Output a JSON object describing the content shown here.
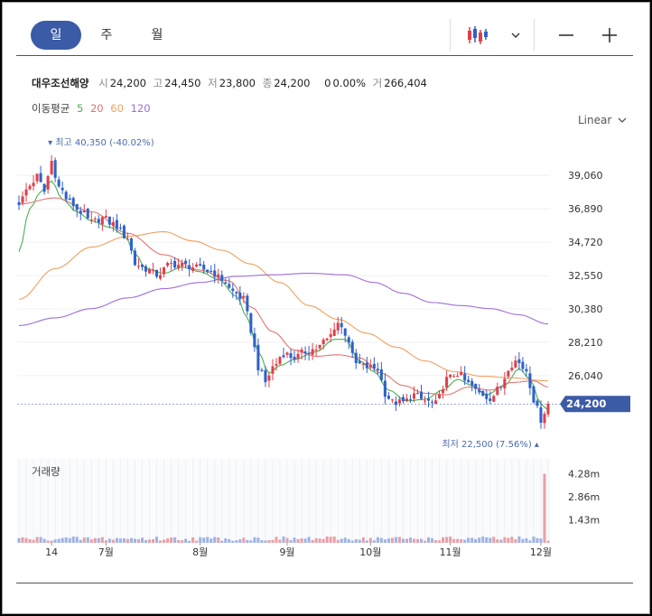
{
  "tabs": [
    {
      "label": "일",
      "active": true
    },
    {
      "label": "주",
      "active": false
    },
    {
      "label": "월",
      "active": false
    }
  ],
  "toolbar": {
    "chart_type_icon": "candlestick-icon",
    "dropdown_icon": "chevron-down-icon",
    "minimize_icon": "minus-icon",
    "add_icon": "plus-icon"
  },
  "stock": {
    "name": "대우조선해양",
    "open_label": "시",
    "open": "24,200",
    "high_label": "고",
    "high": "24,450",
    "low_label": "저",
    "low": "23,800",
    "close_label": "종",
    "close": "24,200",
    "change": "0",
    "change_pct": "0.00%",
    "volume_label": "거",
    "volume": "266,404"
  },
  "ma_legend": {
    "label": "이동평균",
    "periods": [
      {
        "label": "5",
        "color": "#4caf50"
      },
      {
        "label": "20",
        "color": "#e57373"
      },
      {
        "label": "60",
        "color": "#f0a060"
      },
      {
        "label": "120",
        "color": "#a070d8"
      }
    ]
  },
  "scale": {
    "label": "Linear"
  },
  "colors": {
    "up": "#e0404a",
    "down": "#2f62c8",
    "current": "#3b5ba6"
  },
  "chart_data": {
    "type": "candlestick",
    "y_ticks": [
      "39,060",
      "36,890",
      "34,720",
      "32,550",
      "30,380",
      "28,210",
      "26,040",
      "24,200"
    ],
    "y_tick_values": [
      39060,
      36890,
      34720,
      32550,
      30380,
      28210,
      26040
    ],
    "current_price": 24200,
    "current_label": "24,200",
    "ylim": [
      22100,
      41600
    ],
    "high_annotation": {
      "text": "최고 40,350 (-40.02%)",
      "value": 40350,
      "index": 9
    },
    "low_annotation": {
      "text": "최저 22,500 (7.56%)",
      "value": 22500,
      "index": 142
    },
    "x_ticks": [
      {
        "label": "14",
        "index": 9
      },
      {
        "label": "7월",
        "index": 24
      },
      {
        "label": "8월",
        "index": 50
      },
      {
        "label": "9월",
        "index": 74
      },
      {
        "label": "10월",
        "index": 97
      },
      {
        "label": "11월",
        "index": 119
      },
      {
        "label": "12월",
        "index": 144
      }
    ],
    "count": 147,
    "price_anchors": [
      [
        0,
        37300
      ],
      [
        3,
        38400
      ],
      [
        5,
        39000
      ],
      [
        7,
        38000
      ],
      [
        9,
        40000
      ],
      [
        11,
        38300
      ],
      [
        14,
        37300
      ],
      [
        17,
        36700
      ],
      [
        20,
        36000
      ],
      [
        23,
        36300
      ],
      [
        26,
        35900
      ],
      [
        30,
        35000
      ],
      [
        32,
        33300
      ],
      [
        35,
        33000
      ],
      [
        38,
        32600
      ],
      [
        42,
        33300
      ],
      [
        46,
        33200
      ],
      [
        50,
        33000
      ],
      [
        53,
        32800
      ],
      [
        56,
        32300
      ],
      [
        59,
        31500
      ],
      [
        62,
        31000
      ],
      [
        64,
        29000
      ],
      [
        66,
        26600
      ],
      [
        68,
        25600
      ],
      [
        70,
        26600
      ],
      [
        73,
        27500
      ],
      [
        76,
        27200
      ],
      [
        79,
        27600
      ],
      [
        82,
        27800
      ],
      [
        85,
        28400
      ],
      [
        88,
        29500
      ],
      [
        90,
        28800
      ],
      [
        93,
        26800
      ],
      [
        96,
        26600
      ],
      [
        99,
        26500
      ],
      [
        101,
        24900
      ],
      [
        103,
        24300
      ],
      [
        106,
        24300
      ],
      [
        109,
        24800
      ],
      [
        112,
        24400
      ],
      [
        115,
        24200
      ],
      [
        118,
        25800
      ],
      [
        121,
        26200
      ],
      [
        124,
        25500
      ],
      [
        127,
        24900
      ],
      [
        130,
        24600
      ],
      [
        133,
        25300
      ],
      [
        135,
        26600
      ],
      [
        137,
        27000
      ],
      [
        140,
        26400
      ],
      [
        142,
        24500
      ],
      [
        144,
        23200
      ],
      [
        146,
        24200
      ]
    ],
    "ma_anchors": {
      "ma5": [
        [
          0,
          34100
        ],
        [
          3,
          36900
        ],
        [
          6,
          38000
        ],
        [
          9,
          38700
        ],
        [
          12,
          37500
        ],
        [
          16,
          36700
        ],
        [
          20,
          36100
        ],
        [
          25,
          35700
        ],
        [
          29,
          35200
        ],
        [
          32,
          34000
        ],
        [
          35,
          33000
        ],
        [
          40,
          32700
        ],
        [
          45,
          33100
        ],
        [
          50,
          32800
        ],
        [
          55,
          32300
        ],
        [
          60,
          31200
        ],
        [
          63,
          29800
        ],
        [
          66,
          27600
        ],
        [
          69,
          26200
        ],
        [
          72,
          26700
        ],
        [
          76,
          27100
        ],
        [
          82,
          27600
        ],
        [
          87,
          28400
        ],
        [
          90,
          28400
        ],
        [
          94,
          27000
        ],
        [
          98,
          26300
        ],
        [
          102,
          25100
        ],
        [
          107,
          24400
        ],
        [
          112,
          24500
        ],
        [
          117,
          25100
        ],
        [
          121,
          25800
        ],
        [
          125,
          25400
        ],
        [
          129,
          24800
        ],
        [
          134,
          25400
        ],
        [
          138,
          26500
        ],
        [
          141,
          25800
        ],
        [
          144,
          24200
        ],
        [
          146,
          23800
        ]
      ],
      "ma20": [
        [
          0,
          37200
        ],
        [
          10,
          37600
        ],
        [
          20,
          36700
        ],
        [
          30,
          35300
        ],
        [
          40,
          33900
        ],
        [
          50,
          32900
        ],
        [
          58,
          32200
        ],
        [
          64,
          30500
        ],
        [
          70,
          28900
        ],
        [
          76,
          27700
        ],
        [
          82,
          27300
        ],
        [
          88,
          27400
        ],
        [
          94,
          27200
        ],
        [
          100,
          26200
        ],
        [
          106,
          25400
        ],
        [
          112,
          24900
        ],
        [
          118,
          24800
        ],
        [
          124,
          25300
        ],
        [
          130,
          25100
        ],
        [
          136,
          25600
        ],
        [
          142,
          25700
        ],
        [
          146,
          25300
        ]
      ],
      "ma60": [
        [
          0,
          31000
        ],
        [
          10,
          33000
        ],
        [
          20,
          34400
        ],
        [
          30,
          35100
        ],
        [
          40,
          35400
        ],
        [
          48,
          34800
        ],
        [
          56,
          34200
        ],
        [
          64,
          33300
        ],
        [
          72,
          32100
        ],
        [
          80,
          30600
        ],
        [
          88,
          29700
        ],
        [
          96,
          28800
        ],
        [
          104,
          27900
        ],
        [
          112,
          27000
        ],
        [
          120,
          26300
        ],
        [
          128,
          26000
        ],
        [
          136,
          25900
        ],
        [
          146,
          25700
        ]
      ],
      "ma120": [
        [
          0,
          29300
        ],
        [
          10,
          29800
        ],
        [
          20,
          30400
        ],
        [
          30,
          31100
        ],
        [
          40,
          31700
        ],
        [
          50,
          32100
        ],
        [
          60,
          32500
        ],
        [
          70,
          32600
        ],
        [
          80,
          32700
        ],
        [
          90,
          32600
        ],
        [
          98,
          32100
        ],
        [
          106,
          31400
        ],
        [
          114,
          30800
        ],
        [
          122,
          30600
        ],
        [
          130,
          30400
        ],
        [
          138,
          30000
        ],
        [
          146,
          29400
        ]
      ]
    },
    "volume": {
      "label": "거래량",
      "ticks": [
        "4.28m",
        "2.86m",
        "1.43m"
      ],
      "tick_values": [
        4280000,
        2860000,
        1430000
      ],
      "max": 5200000,
      "spike": {
        "index": 145,
        "value": 4280000
      }
    }
  }
}
